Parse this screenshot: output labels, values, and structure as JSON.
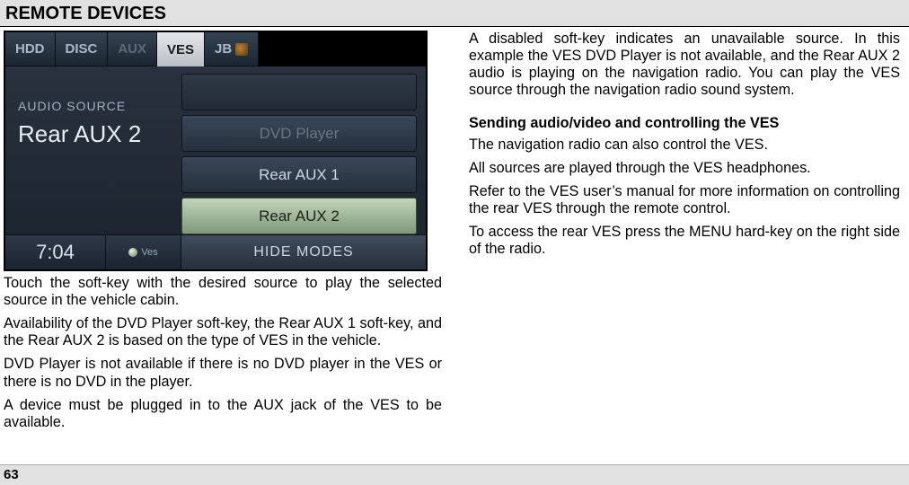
{
  "title": "REMOTE DEVICES",
  "page_number": "63",
  "radio": {
    "tabs": {
      "hdd": "HDD",
      "disc": "DISC",
      "aux": "AUX",
      "ves": "VES",
      "jb": "JB"
    },
    "audio_source_label": "AUDIO SOURCE",
    "audio_source_value": "Rear AUX 2",
    "softkeys": {
      "dvd": "DVD Player",
      "aux1": "Rear AUX 1",
      "aux2": "Rear AUX 2"
    },
    "clock": "7:04",
    "ves_indicator": "Ves",
    "hide_modes": "HIDE MODES"
  },
  "left_paragraphs": [
    "Touch the soft-key with the desired source to play the selected source in the vehicle cabin.",
    "Availability of the DVD Player soft-key, the Rear AUX 1 soft-key, and the Rear AUX 2 is based on the type of VES in the vehicle.",
    "DVD Player is not available if there is no DVD player in the VES or there is no DVD in the player.",
    "A device must be plugged in to the AUX jack of the VES to be available."
  ],
  "right_top_paragraph": "A disabled soft-key indicates an unavailable source. In this example the VES DVD Player  is not available, and the Rear AUX 2 audio is playing on the navigation radio. You can play the VES source through the navigation radio sound system.",
  "right_subhead": "Sending audio/video and controlling the VES",
  "right_paragraphs": [
    "The navigation radio can also control the VES.",
    "All sources are played through the VES headphones.",
    "Refer to the VES user’s manual for more information on controlling the rear VES through the remote control.",
    "To access the rear VES press the MENU hard-key on the right side of the radio."
  ]
}
